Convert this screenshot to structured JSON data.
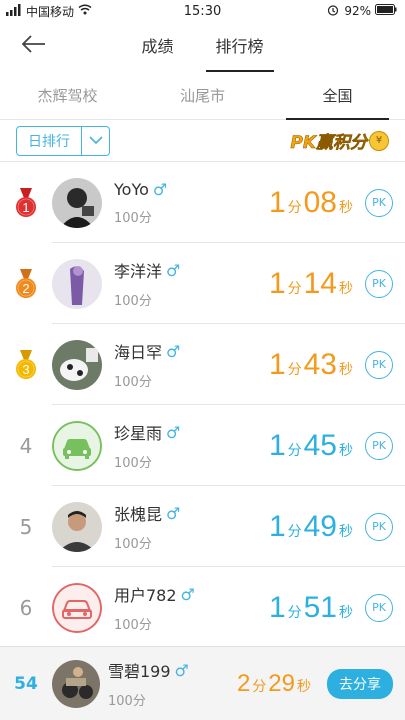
{
  "status_bar": {
    "carrier": "中国移动",
    "time": "15:30",
    "battery": "92%"
  },
  "nav": {
    "tabs": [
      {
        "label": "成绩",
        "active": false
      },
      {
        "label": "排行榜",
        "active": true
      }
    ]
  },
  "scope_tabs": [
    {
      "label": "杰辉驾校",
      "active": false
    },
    {
      "label": "汕尾市",
      "active": false
    },
    {
      "label": "全国",
      "active": true
    }
  ],
  "filter": {
    "period": "日排行",
    "banner_text": "PK赢积分",
    "banner_coin": "¥"
  },
  "rankings": [
    {
      "rank": "1",
      "medal": true,
      "name": "YoYo",
      "gender": "♂",
      "score": "100分",
      "min": "1",
      "min_unit": "分",
      "sec": "08",
      "sec_unit": "秒",
      "pk": "PK",
      "color": "gold"
    },
    {
      "rank": "2",
      "medal": true,
      "name": "李洋洋",
      "gender": "♂",
      "score": "100分",
      "min": "1",
      "min_unit": "分",
      "sec": "14",
      "sec_unit": "秒",
      "pk": "PK",
      "color": "gold"
    },
    {
      "rank": "3",
      "medal": true,
      "name": "海日罕",
      "gender": "♂",
      "score": "100分",
      "min": "1",
      "min_unit": "分",
      "sec": "43",
      "sec_unit": "秒",
      "pk": "PK",
      "color": "gold"
    },
    {
      "rank": "4",
      "medal": false,
      "name": "珍星雨",
      "gender": "♂",
      "score": "100分",
      "min": "1",
      "min_unit": "分",
      "sec": "45",
      "sec_unit": "秒",
      "pk": "PK",
      "color": "blue"
    },
    {
      "rank": "5",
      "medal": false,
      "name": "张槐昆",
      "gender": "♂",
      "score": "100分",
      "min": "1",
      "min_unit": "分",
      "sec": "49",
      "sec_unit": "秒",
      "pk": "PK",
      "color": "blue"
    },
    {
      "rank": "6",
      "medal": false,
      "name": "用户782",
      "gender": "♂",
      "score": "100分",
      "min": "1",
      "min_unit": "分",
      "sec": "51",
      "sec_unit": "秒",
      "pk": "PK",
      "color": "blue"
    }
  ],
  "me": {
    "rank": "54",
    "name": "雪碧199",
    "gender": "♂",
    "score": "100分",
    "min": "2",
    "min_unit": "分",
    "sec": "29",
    "sec_unit": "秒",
    "share_label": "去分享"
  },
  "colors": {
    "accent_blue": "#2db0e0",
    "gold": "#f39a1d",
    "medal_red": "#e03131",
    "medal_orange": "#f08a1c",
    "medal_yellow": "#f5b800"
  },
  "icons": {
    "back": "arrow-left-icon",
    "wifi": "wifi-icon",
    "battery": "battery-icon",
    "alarm": "alarm-icon",
    "dropdown": "chevron-down-icon",
    "car": "car-icon"
  }
}
